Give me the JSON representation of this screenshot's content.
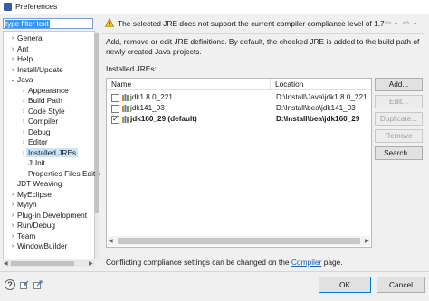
{
  "window": {
    "title": "Preferences"
  },
  "filter": {
    "value": "type filter text"
  },
  "tree": [
    {
      "label": "General",
      "indent": 0,
      "twisty": "›"
    },
    {
      "label": "Ant",
      "indent": 0,
      "twisty": "›"
    },
    {
      "label": "Help",
      "indent": 0,
      "twisty": "›"
    },
    {
      "label": "Install/Update",
      "indent": 0,
      "twisty": "›"
    },
    {
      "label": "Java",
      "indent": 0,
      "twisty": "⌄"
    },
    {
      "label": "Appearance",
      "indent": 1,
      "twisty": "›"
    },
    {
      "label": "Build Path",
      "indent": 1,
      "twisty": "›"
    },
    {
      "label": "Code Style",
      "indent": 1,
      "twisty": "›"
    },
    {
      "label": "Compiler",
      "indent": 1,
      "twisty": "›"
    },
    {
      "label": "Debug",
      "indent": 1,
      "twisty": "›"
    },
    {
      "label": "Editor",
      "indent": 1,
      "twisty": "›"
    },
    {
      "label": "Installed JREs",
      "indent": 1,
      "twisty": "›",
      "selected": true
    },
    {
      "label": "JUnit",
      "indent": 1,
      "twisty": ""
    },
    {
      "label": "Properties Files Edito",
      "indent": 1,
      "twisty": ""
    },
    {
      "label": "JDT Weaving",
      "indent": 0,
      "twisty": ""
    },
    {
      "label": "MyEclipse",
      "indent": 0,
      "twisty": "›"
    },
    {
      "label": "Mylyn",
      "indent": 0,
      "twisty": "›"
    },
    {
      "label": "Plug-in Development",
      "indent": 0,
      "twisty": "›"
    },
    {
      "label": "Run/Debug",
      "indent": 0,
      "twisty": "›"
    },
    {
      "label": "Team",
      "indent": 0,
      "twisty": "›"
    },
    {
      "label": "WindowBuilder",
      "indent": 0,
      "twisty": "›"
    }
  ],
  "warning": "The selected JRE does not support the current compiler compliance level of 1.7",
  "description": "Add, remove or edit JRE definitions. By default, the checked JRE is added to the build path of newly created Java projects.",
  "installed_label": "Installed JREs:",
  "table": {
    "columns": [
      "Name",
      "Location"
    ],
    "rows": [
      {
        "name": "jdk1.8.0_221",
        "location": "D:\\Install\\Java\\jdk1.8.0_221",
        "checked": false,
        "bold": false
      },
      {
        "name": "jdk141_03",
        "location": "D:\\Install\\bea\\jdk141_03",
        "checked": false,
        "bold": false
      },
      {
        "name": "jdk160_29 (default)",
        "location": "D:\\Install\\bea\\jdk160_29",
        "checked": true,
        "bold": true
      }
    ]
  },
  "buttons": {
    "add": "Add...",
    "edit": "Edit...",
    "duplicate": "Duplicate...",
    "remove": "Remove",
    "search": "Search..."
  },
  "footer": {
    "prefix": "Conflicting compliance settings can be changed on the ",
    "link": "Compiler",
    "suffix": " page."
  },
  "dialog": {
    "ok": "OK",
    "cancel": "Cancel"
  },
  "colors": {
    "selection": "#cce4f7",
    "accent": "#0078d7",
    "link": "#1a5fb4",
    "filter_highlight": "#3399ff"
  }
}
